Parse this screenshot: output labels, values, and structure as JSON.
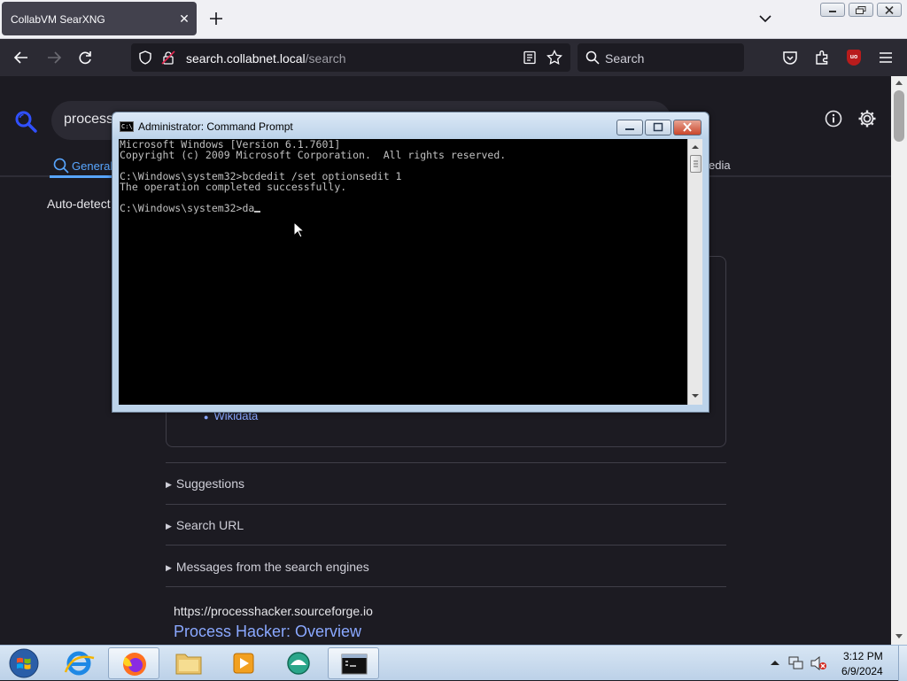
{
  "browser": {
    "tab_title": "CollabVM SearXNG",
    "url_host": "search.collabnet.local",
    "url_path": "/search",
    "search_placeholder": "Search"
  },
  "page": {
    "query": "process",
    "category_general": "General",
    "category_media": "edia",
    "language": "Auto-detect",
    "infobox_link": "Wikidata",
    "suggestions": "Suggestions",
    "search_url": "Search URL",
    "messages": "Messages from the search engines",
    "result_url": "https://processhacker.sourceforge.io",
    "result_title": "Process Hacker: Overview"
  },
  "cmd": {
    "title": "Administrator: Command Prompt",
    "icon_text": "C:\\",
    "lines": [
      "Microsoft Windows [Version 6.1.7601]",
      "Copyright (c) 2009 Microsoft Corporation.  All rights reserved.",
      "",
      "C:\\Windows\\system32>bcdedit /set optionsedit 1",
      "The operation completed successfully.",
      "",
      "C:\\Windows\\system32>da"
    ]
  },
  "taskbar": {
    "time": "3:12 PM",
    "date": "6/9/2024",
    "items": [
      "internet-explorer",
      "firefox",
      "file-explorer",
      "media-player",
      "chat-app",
      "command-prompt"
    ]
  },
  "colors": {
    "accent": "#58a6ff",
    "page_bg": "#1c1b22",
    "link": "#8aa8ff"
  }
}
